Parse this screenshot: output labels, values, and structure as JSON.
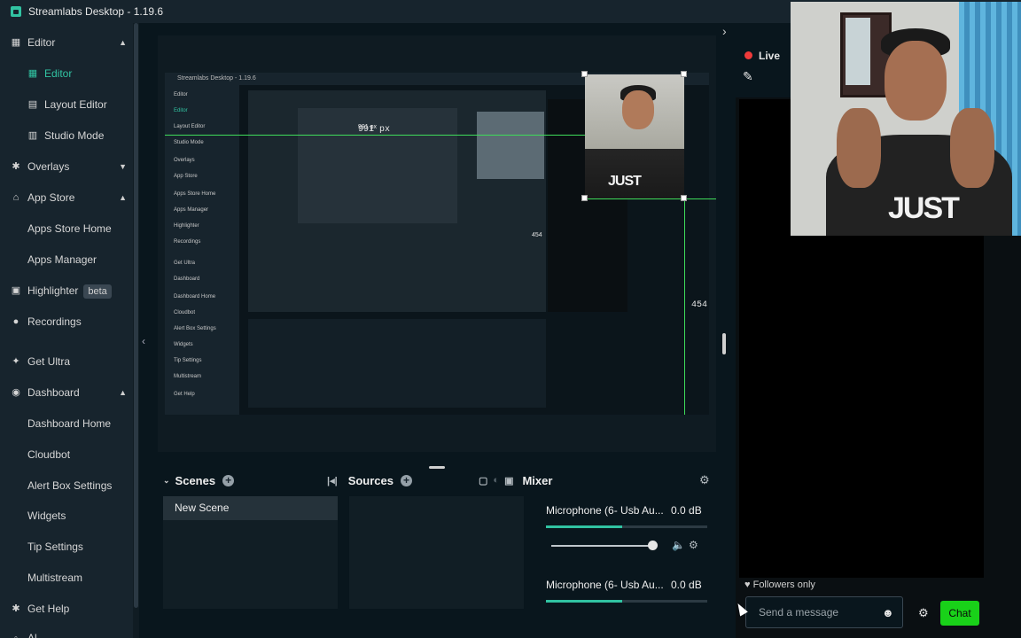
{
  "titlebar": {
    "title": "Streamlabs Desktop - 1.19.6"
  },
  "sidebar": {
    "items": [
      {
        "label": "Editor",
        "icon": "editor-icon",
        "active": false,
        "chevron": "up"
      },
      {
        "label": "Editor",
        "icon": "editor-icon",
        "active": true,
        "sub": true
      },
      {
        "label": "Layout Editor",
        "icon": "layout-icon",
        "sub": true
      },
      {
        "label": "Studio Mode",
        "icon": "studio-icon",
        "sub": true
      },
      {
        "label": "Overlays",
        "icon": "overlays-icon",
        "chevron": "down"
      },
      {
        "label": "App Store",
        "icon": "store-icon",
        "chevron": "up"
      },
      {
        "label": "Apps Store Home",
        "sub": true
      },
      {
        "label": "Apps Manager",
        "sub": true
      },
      {
        "label": "Highlighter",
        "icon": "highlighter-icon",
        "badge": "beta"
      },
      {
        "label": "Recordings",
        "icon": "recordings-icon"
      },
      {
        "label": "Get Ultra",
        "icon": "ultra-icon"
      },
      {
        "label": "Dashboard",
        "icon": "dashboard-icon",
        "chevron": "up"
      },
      {
        "label": "Dashboard Home",
        "sub": true
      },
      {
        "label": "Cloudbot",
        "sub": true
      },
      {
        "label": "Alert Box Settings",
        "sub": true
      },
      {
        "label": "Widgets",
        "sub": true
      },
      {
        "label": "Tip Settings",
        "sub": true
      },
      {
        "label": "Multistream",
        "sub": true
      },
      {
        "label": "Get Help",
        "icon": "help-icon"
      },
      {
        "label": "Al",
        "icon": "more-icon"
      }
    ]
  },
  "preview": {
    "width_label": "991 px",
    "height_label": "454",
    "nested_title": "Streamlabs Desktop - 1.19.6",
    "nested_width_label": "991 px",
    "nested_height_label": "454",
    "tshirt_text": "JUST"
  },
  "panels": {
    "scenes_title": "Scenes",
    "sources_title": "Sources",
    "mixer_title": "Mixer",
    "scene_items": [
      "New Scene"
    ],
    "mixer": [
      {
        "name": "Microphone (6- Usb Au...",
        "db": "0.0 dB",
        "level": 0.47,
        "volume": 0.95
      },
      {
        "name": "Microphone (6- Usb Au...",
        "db": "0.0 dB",
        "level": 0.47
      }
    ]
  },
  "chat": {
    "live_label": "Live",
    "followers_label": "Followers only",
    "message_placeholder": "Send a message",
    "chat_button": "Chat"
  },
  "webcam": {
    "tshirt_text": "JUST"
  }
}
